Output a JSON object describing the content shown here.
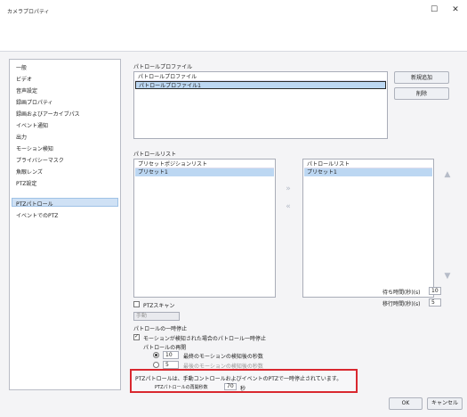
{
  "window": {
    "title": "カメラプロパティ",
    "maximize_glyph": "☐",
    "close_glyph": "✕"
  },
  "sidebar": {
    "items": [
      {
        "label": "一般"
      },
      {
        "label": "ビデオ"
      },
      {
        "label": "音声設定"
      },
      {
        "label": "録画プロパティ"
      },
      {
        "label": "録画およびアーカイブパス"
      },
      {
        "label": "イベント通知"
      },
      {
        "label": "出力"
      },
      {
        "label": "モーション検知"
      },
      {
        "label": "プライバシーマスク"
      },
      {
        "label": "魚眼レンズ"
      },
      {
        "label": "PTZ設定"
      },
      {
        "label": "PTZパトロール",
        "selected": true
      },
      {
        "label": "イベントでのPTZ"
      }
    ]
  },
  "profile": {
    "section_label": "パトロールプロファイル",
    "dropdown_value": "パトロールプロファイル",
    "list_selected": "パトロールプロファイル1",
    "new_button": "新規追加",
    "delete_button": "削除"
  },
  "patrol_list": {
    "section_label": "パトロールリスト",
    "left_header": "プリセットポジションリスト",
    "left_selected": "プリセット1",
    "right_header": "パトロールリスト",
    "right_selected": "プリセット1",
    "arrow_right": "»",
    "arrow_left": "«",
    "arrow_up": "▲",
    "arrow_down": "▼"
  },
  "ptz_scan": {
    "label": "PTZスキャン",
    "field_value": "手動"
  },
  "timing": {
    "wait_label": "待ち時間(秒)(s)",
    "wait_value": "10",
    "move_label": "移行時間(秒)(s)",
    "move_value": "5"
  },
  "pause": {
    "section_label": "パトロールの一時停止",
    "motion_checkbox_label": "モーションが検知された場合のパトロール一時停止",
    "resume_label": "パトロールの再開",
    "radio1_value": "10",
    "radio1_label": "最終のモーションの検知後の秒数",
    "radio2_value": "5",
    "radio2_label": "最後のモーションの検知後の秒数"
  },
  "notice": {
    "text": "PTZパトロールは、手動コントロールおよびイベントのPTZで一時停止されています。",
    "timeout_label": "PTZパトロールの再開秒数",
    "timeout_value": "70",
    "timeout_unit": "秒"
  },
  "footer": {
    "ok_button": "OK",
    "cancel_button": "キャンセル"
  }
}
